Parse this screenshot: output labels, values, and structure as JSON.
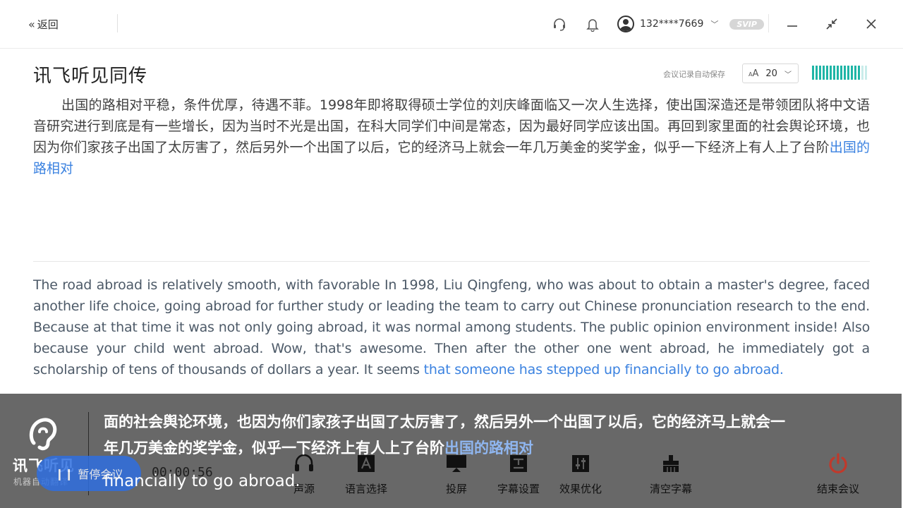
{
  "header": {
    "back_label": "返回",
    "user_phone": "132****7669",
    "svip_badge": "SVIP"
  },
  "title_row": {
    "title": "讯飞听见同传",
    "autosave_note": "会议记录自动保存",
    "font_size_value": "20"
  },
  "transcript": {
    "zh_main": "出国的路相对平稳，条件优厚，待遇不菲。1998年即将取得硕士学位的刘庆峰面临又一次人生选择，使出国深造还是带领团队将中文语音研究进行到底是有一些增长，因为当时不光是出国，在科大同学们中间是常态，因为最好同学应该出国。再回到家里面的社会舆论环境，也因为你们家孩子出国了太厉害了，然后另外一个出国了以后，它的经济马上就会一年几万美金的奖学金，似乎一下经济上有人上了台阶",
    "zh_highlight": "出国的路相对",
    "en_main": "The road abroad is relatively smooth, with favorable In 1998, Liu Qingfeng, who was about to obtain a master's degree, faced another life choice, going abroad for further study or leading the team to carry out Chinese pronunciation research to the end. Because at that time it was not only going abroad, it was normal among students. The public opinion environment inside! Also because your child went abroad. Wow, that's awesome. Then after the other one went abroad, he immediately got a scholarship of tens of thousands of dollars a year. It seems ",
    "en_highlight": "that someone has stepped up financially to go abroad."
  },
  "subtitle_bar": {
    "brand_title": "讯飞听见",
    "brand_subtitle": "机器自动翻译",
    "line1": "面的社会舆论环境，也因为你们家孩子出国了太厉害了，然后另外一个出国了以后，它的经济马上就会一",
    "line2_main": "年几万美金的奖学金，似乎一下经济上有人上了台阶",
    "line2_highlight": "出国的路相对",
    "line_en": "financially to go abroad."
  },
  "controls": {
    "pause_label": "暂停会议",
    "timer": "00:00:56",
    "tools": [
      {
        "label": "声源",
        "icon": "headset-icon"
      },
      {
        "label": "语言选择",
        "icon": "language-icon"
      },
      {
        "label": "投屏",
        "icon": "cast-screen-icon"
      },
      {
        "label": "字幕设置",
        "icon": "subtitle-settings-icon"
      },
      {
        "label": "效果优化",
        "icon": "tuning-sliders-icon"
      },
      {
        "label": "清空字幕",
        "icon": "clear-brush-icon"
      },
      {
        "label": "结束会议",
        "icon": "power-icon"
      }
    ]
  },
  "colors": {
    "accent_blue": "#3b82e0",
    "level_teal": "#1fb5a6",
    "end_red": "#c0392b",
    "bottom_bar": "#5f5f5f"
  },
  "audio_level": {
    "active_bars": 14,
    "total_bars": 16
  }
}
